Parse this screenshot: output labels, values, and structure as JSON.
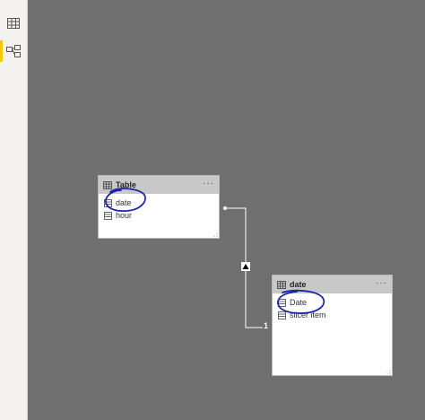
{
  "sidebar": {
    "items": [
      {
        "name": "data-view",
        "icon": "table-grid-icon",
        "active": false
      },
      {
        "name": "model-view",
        "icon": "model-diagram-icon",
        "active": true
      }
    ]
  },
  "tables": [
    {
      "title": "Table",
      "more": "···",
      "fields": [
        {
          "label": "date",
          "icon": "column-icon",
          "circled": true
        },
        {
          "label": "hour",
          "icon": "column-icon",
          "circled": false
        }
      ]
    },
    {
      "title": "date",
      "more": "···",
      "fields": [
        {
          "label": "Date",
          "icon": "column-icon",
          "circled": true
        },
        {
          "label": "slicer item",
          "icon": "column-icon",
          "circled": false
        }
      ]
    }
  ],
  "relationship": {
    "many_side_marker": "dot",
    "one_side_label": "1",
    "filter_direction": "up"
  },
  "colors": {
    "canvas": "#6f6f6f",
    "annotation": "#1c24a8",
    "active_tab": "#f2c811"
  }
}
